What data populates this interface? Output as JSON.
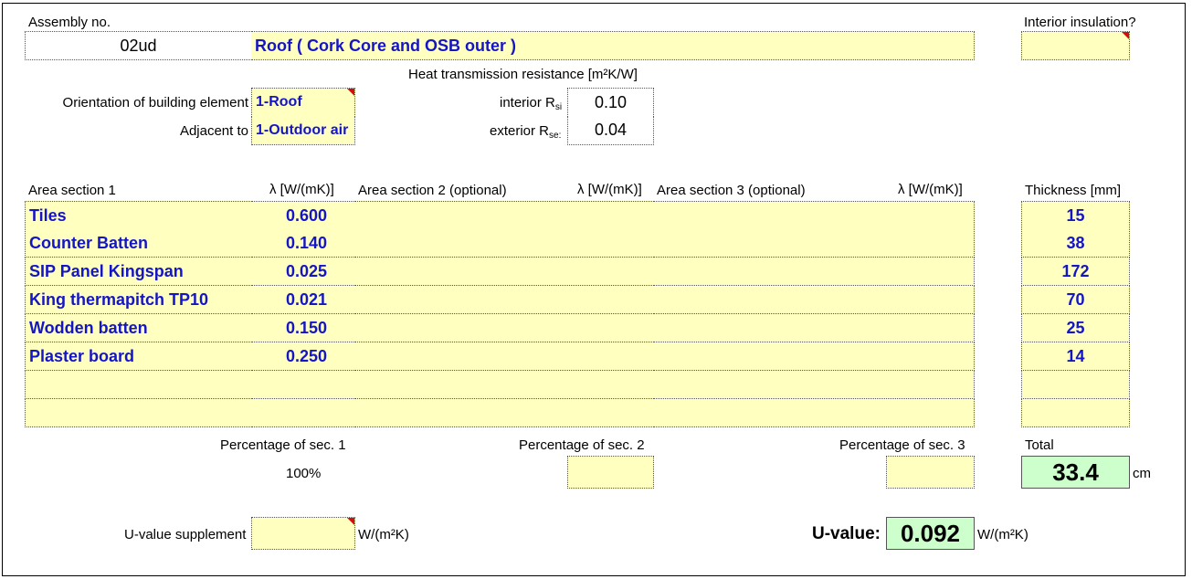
{
  "header": {
    "assembly_label": "Assembly no.",
    "assembly_value": "02ud",
    "title": "Roof ( Cork Core and OSB outer )",
    "interior_insulation_label": "Interior insulation?",
    "interior_insulation_value": ""
  },
  "resistance": {
    "heading": "Heat transmission resistance  [m²K/W]",
    "interior_label": "interior R",
    "interior_sub": "si",
    "interior_value": "0.10",
    "exterior_label": "exterior R",
    "exterior_sub": "se:",
    "exterior_value": "0.04"
  },
  "orientation": {
    "label": "Orientation of building element",
    "value": "1-Roof"
  },
  "adjacent": {
    "label": "Adjacent to",
    "value": "1-Outdoor air"
  },
  "columns": {
    "area1": "Area section 1",
    "lambda1": "λ [W/(mK)]",
    "area2": "Area section 2 (optional)",
    "lambda2": "λ [W/(mK)]",
    "area3": "Area section 3 (optional)",
    "lambda3": "λ [W/(mK)]",
    "thickness": "Thickness [mm]"
  },
  "layers": [
    {
      "name": "Tiles",
      "lambda": "0.600",
      "thickness": "15"
    },
    {
      "name": "Counter Batten",
      "lambda": "0.140",
      "thickness": "38"
    },
    {
      "name": "SIP Panel Kingspan",
      "lambda": "0.025",
      "thickness": "172"
    },
    {
      "name": "King thermapitch TP10",
      "lambda": "0.021",
      "thickness": "70"
    },
    {
      "name": "Wodden batten",
      "lambda": "0.150",
      "thickness": "25"
    },
    {
      "name": "Plaster board",
      "lambda": "0.250",
      "thickness": "14"
    },
    {
      "name": "",
      "lambda": "",
      "thickness": ""
    },
    {
      "name": "",
      "lambda": "",
      "thickness": ""
    }
  ],
  "percentages": {
    "sec1_label": "Percentage of sec. 1",
    "sec1_value": "100%",
    "sec2_label": "Percentage of sec. 2",
    "sec2_value": "",
    "sec3_label": "Percentage of sec. 3",
    "sec3_value": ""
  },
  "total": {
    "label": "Total",
    "value": "33.4",
    "unit": "cm"
  },
  "u_supplement": {
    "label": "U-value supplement",
    "value": "",
    "unit": "W/(m²K)"
  },
  "u_value": {
    "label": "U-value:",
    "value": "0.092",
    "unit": "W/(m²K)"
  },
  "colors": {
    "input_fill": "#ffffc0",
    "result_fill": "#ccffcc",
    "input_text": "#1515c8",
    "comment_marker": "#d01010"
  }
}
